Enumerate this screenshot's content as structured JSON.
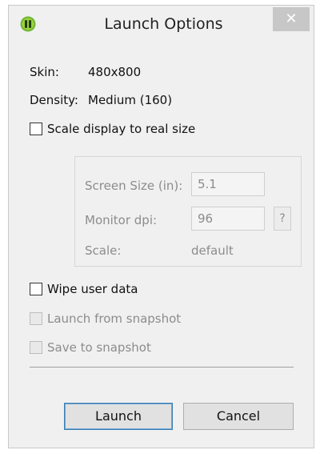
{
  "window": {
    "title": "Launch Options",
    "close_glyph": "✕",
    "icon": "android-icon",
    "accent_color": "#3c7fb1"
  },
  "info": {
    "skin_label": "Skin:",
    "skin_value": "480x800",
    "density_label": "Density:",
    "density_value": "Medium (160)"
  },
  "scale_display": {
    "label": "Scale display to real size",
    "checked": false
  },
  "scale_group": {
    "screen_size_label": "Screen Size (in):",
    "screen_size_value": "5.1",
    "monitor_dpi_label": "Monitor dpi:",
    "monitor_dpi_value": "96",
    "help_label": "?",
    "scale_label": "Scale:",
    "scale_value": "default"
  },
  "options": {
    "wipe_user_data": "Wipe user data",
    "launch_from_snapshot": "Launch from snapshot",
    "save_to_snapshot": "Save to snapshot"
  },
  "buttons": {
    "launch": "Launch",
    "cancel": "Cancel"
  }
}
